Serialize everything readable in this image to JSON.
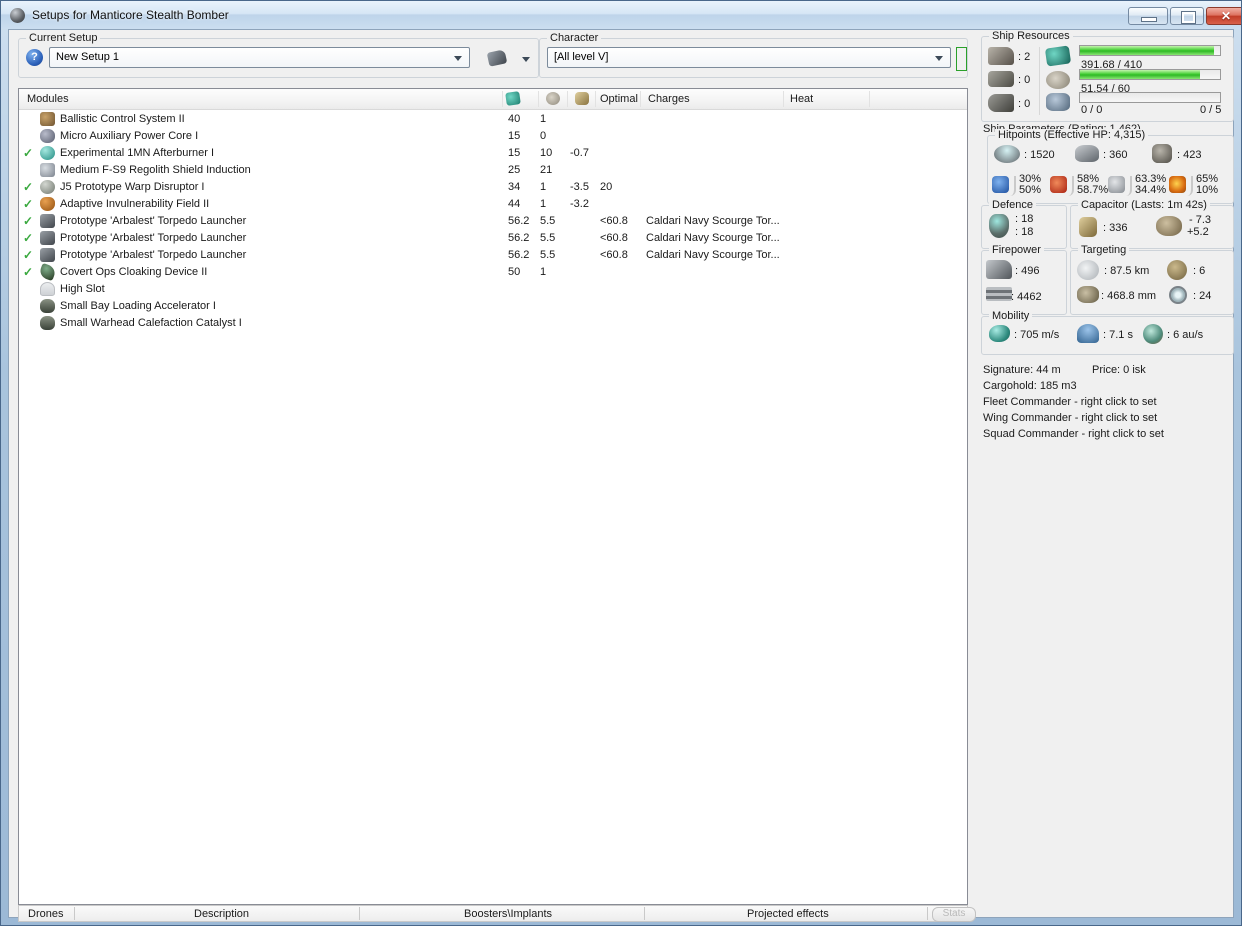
{
  "window": {
    "title": "Setups for Manticore Stealth Bomber"
  },
  "colors": {
    "bar_green": "#3ed32f",
    "check_green": "#3aa93f",
    "character_status_green": "#33cc33",
    "close_red": "#c13c27"
  },
  "icons": {
    "help_glyph": "?",
    "close_glyph": "✕",
    "check_glyph": "✓"
  },
  "setup": {
    "label": "Current Setup",
    "value": "New Setup 1"
  },
  "character": {
    "label": "Character",
    "value": "[All level V]"
  },
  "modules": {
    "headers": {
      "name": "Modules",
      "optimal": "Optimal",
      "charges": "Charges",
      "heat": "Heat"
    },
    "rows": [
      {
        "checked": false,
        "icon": "bcs-icon",
        "name": "Ballistic Control System II",
        "cpu": "40",
        "pg": "1",
        "cap": "",
        "optimal": "",
        "charges": ""
      },
      {
        "checked": false,
        "icon": "power-core-icon",
        "name": "Micro Auxiliary Power Core I",
        "cpu": "15",
        "pg": "0",
        "cap": "",
        "optimal": "",
        "charges": ""
      },
      {
        "checked": true,
        "icon": "afterburner-icon",
        "name": "Experimental 1MN Afterburner I",
        "cpu": "15",
        "pg": "10",
        "cap": "-0.7",
        "optimal": "",
        "charges": ""
      },
      {
        "checked": false,
        "icon": "shield-extender-icon",
        "name": "Medium F-S9 Regolith Shield Induction",
        "cpu": "25",
        "pg": "21",
        "cap": "",
        "optimal": "",
        "charges": ""
      },
      {
        "checked": true,
        "icon": "warp-disruptor-icon",
        "name": "J5 Prototype Warp Disruptor I",
        "cpu": "34",
        "pg": "1",
        "cap": "-3.5",
        "optimal": "20",
        "charges": ""
      },
      {
        "checked": true,
        "icon": "invuln-field-icon",
        "name": "Adaptive Invulnerability Field II",
        "cpu": "44",
        "pg": "1",
        "cap": "-3.2",
        "optimal": "",
        "charges": ""
      },
      {
        "checked": true,
        "icon": "torpedo-launcher-icon",
        "name": "Prototype 'Arbalest' Torpedo Launcher",
        "cpu": "56.2",
        "pg": "5.5",
        "cap": "",
        "optimal": "<60.8",
        "charges": "Caldari Navy Scourge Tor..."
      },
      {
        "checked": true,
        "icon": "torpedo-launcher-icon",
        "name": "Prototype 'Arbalest' Torpedo Launcher",
        "cpu": "56.2",
        "pg": "5.5",
        "cap": "",
        "optimal": "<60.8",
        "charges": "Caldari Navy Scourge Tor..."
      },
      {
        "checked": true,
        "icon": "torpedo-launcher-icon",
        "name": "Prototype 'Arbalest' Torpedo Launcher",
        "cpu": "56.2",
        "pg": "5.5",
        "cap": "",
        "optimal": "<60.8",
        "charges": "Caldari Navy Scourge Tor..."
      },
      {
        "checked": true,
        "icon": "cloak-icon",
        "name": "Covert Ops Cloaking Device II",
        "cpu": "50",
        "pg": "1",
        "cap": "",
        "optimal": "",
        "charges": ""
      },
      {
        "checked": false,
        "icon": "empty-high-slot-icon",
        "name": "High Slot",
        "cpu": "",
        "pg": "",
        "cap": "",
        "optimal": "",
        "charges": ""
      },
      {
        "checked": false,
        "icon": "rig-icon",
        "name": "Small Bay Loading Accelerator I",
        "cpu": "",
        "pg": "",
        "cap": "",
        "optimal": "",
        "charges": ""
      },
      {
        "checked": false,
        "icon": "rig-icon",
        "name": "Small Warhead Calefaction Catalyst I",
        "cpu": "",
        "pg": "",
        "cap": "",
        "optimal": "",
        "charges": ""
      }
    ]
  },
  "bottom_tabs": {
    "items": [
      {
        "label": "Drones"
      },
      {
        "label": "Description"
      },
      {
        "label": "Boosters\\Implants"
      },
      {
        "label": "Projected effects"
      }
    ],
    "stats_button": "Stats"
  },
  "ship_resources": {
    "title": "Ship Resources",
    "turrets": ": 2",
    "launchers": ": 0",
    "rigs": ": 0",
    "cpu": {
      "text": "391.68 / 410",
      "pct": 95.5
    },
    "powergrid": {
      "text": "51.54 / 60",
      "pct": 86
    },
    "drones": {
      "text": "0 / 0",
      "right": "0 / 5",
      "pct": 0
    }
  },
  "ship_parameters": {
    "title": "Ship Parameters (Rating: 1,462)",
    "hitpoints": {
      "title": "Hitpoints (Effective HP: 4,315)",
      "shield": ": 1520",
      "armor": ": 360",
      "hull": ": 423",
      "resists": [
        {
          "name": "em",
          "top": "30%",
          "bottom": "50%"
        },
        {
          "name": "thermal",
          "top": "58%",
          "bottom": "58.7%"
        },
        {
          "name": "kinetic",
          "top": "63.3%",
          "bottom": "34.4%"
        },
        {
          "name": "explosive",
          "top": "65%",
          "bottom": "10%"
        }
      ]
    },
    "defence": {
      "title": "Defence",
      "line1": ": 18",
      "line2": ": 18"
    },
    "capacitor": {
      "title": "Capacitor (Lasts: 1m 42s)",
      "amount": ": 336",
      "delta_out": "- 7.3",
      "delta_in": "+5.2"
    },
    "firepower": {
      "title": "Firepower",
      "volley": ": 496",
      "dps": ": 4462"
    },
    "targeting": {
      "title": "Targeting",
      "range": ": 87.5 km",
      "max_targets": ": 6",
      "scan_res": ": 468.8 mm",
      "sensor_strength": ": 24"
    },
    "mobility": {
      "title": "Mobility",
      "speed": ": 705 m/s",
      "align_time": ": 7.1 s",
      "warp_speed": ": 6 au/s"
    },
    "info": [
      "Signature: 44 m",
      "Price: 0 isk",
      "Cargohold: 185 m3",
      "Fleet Commander - right click to set",
      "Wing Commander - right click to set",
      "Squad Commander - right click to set"
    ]
  }
}
